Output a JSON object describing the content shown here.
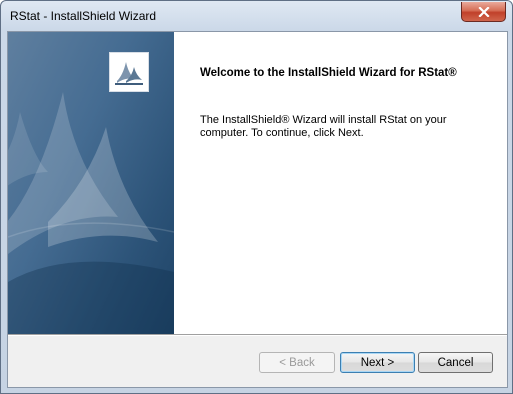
{
  "window": {
    "title": "RStat - InstallShield Wizard",
    "close_icon": "close-icon"
  },
  "banner": {
    "logo_icon": "installshield-logo-icon"
  },
  "content": {
    "heading": "Welcome to the InstallShield Wizard for RStat®",
    "description": "The InstallShield® Wizard will install RStat on your computer.  To continue, click Next."
  },
  "buttons": {
    "back": "< Back",
    "next": "Next >",
    "cancel": "Cancel"
  },
  "colors": {
    "banner_dark": "#1f4467",
    "banner_light": "#5f7f9f",
    "close_red": "#c0402a",
    "default_button_border": "#3c7fb1"
  }
}
